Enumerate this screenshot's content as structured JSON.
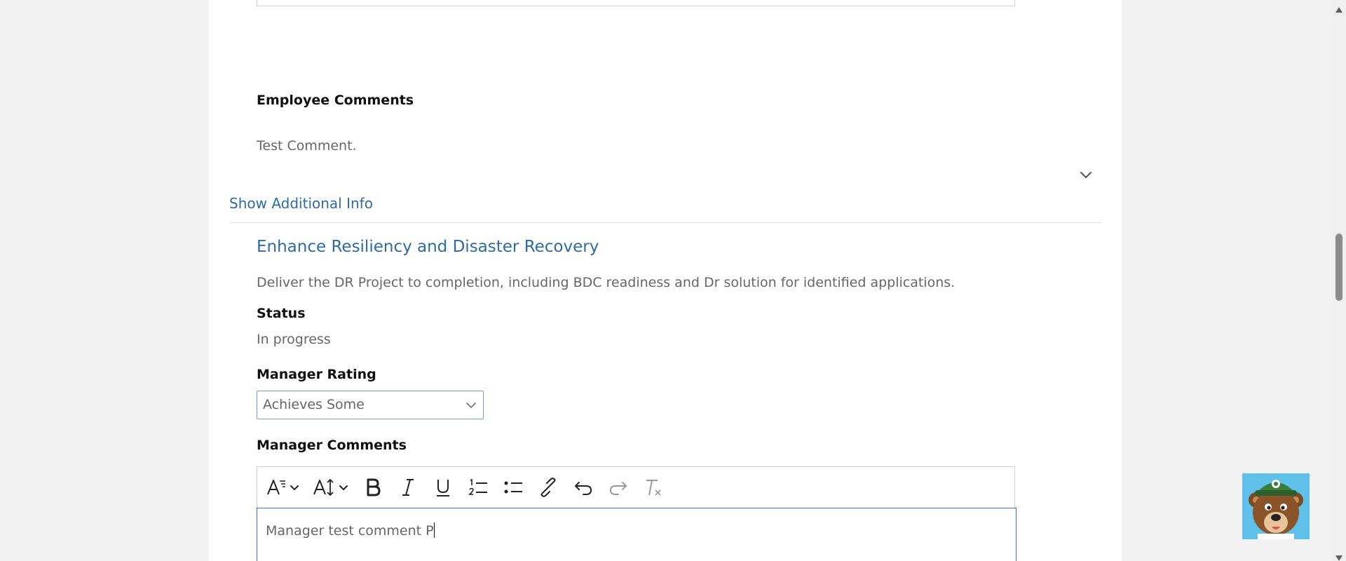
{
  "employee_comments": {
    "label": "Employee Comments",
    "text": "Test Comment."
  },
  "show_additional_info": "Show Additional Info",
  "goal": {
    "title": "Enhance Resiliency and Disaster Recovery",
    "description": "Deliver the DR Project to completion, including BDC readiness and Dr solution for identified applications.",
    "status_label": "Status",
    "status_value": "In progress",
    "manager_rating_label": "Manager Rating",
    "manager_rating_value": "Achieves Some",
    "manager_comments_label": "Manager Comments",
    "manager_comments_text": "Manager test comment P"
  },
  "toolbar": [
    "font-style-icon",
    "font-size-icon",
    "bold-icon",
    "italic-icon",
    "underline-icon",
    "numbered-list-icon",
    "bullet-list-icon",
    "link-icon",
    "undo-icon",
    "redo-icon",
    "clear-formatting-icon"
  ],
  "colors": {
    "link": "#2e6aa6",
    "focus_border": "#3b6fd4",
    "mascot_bg": "#5fc1ea"
  }
}
